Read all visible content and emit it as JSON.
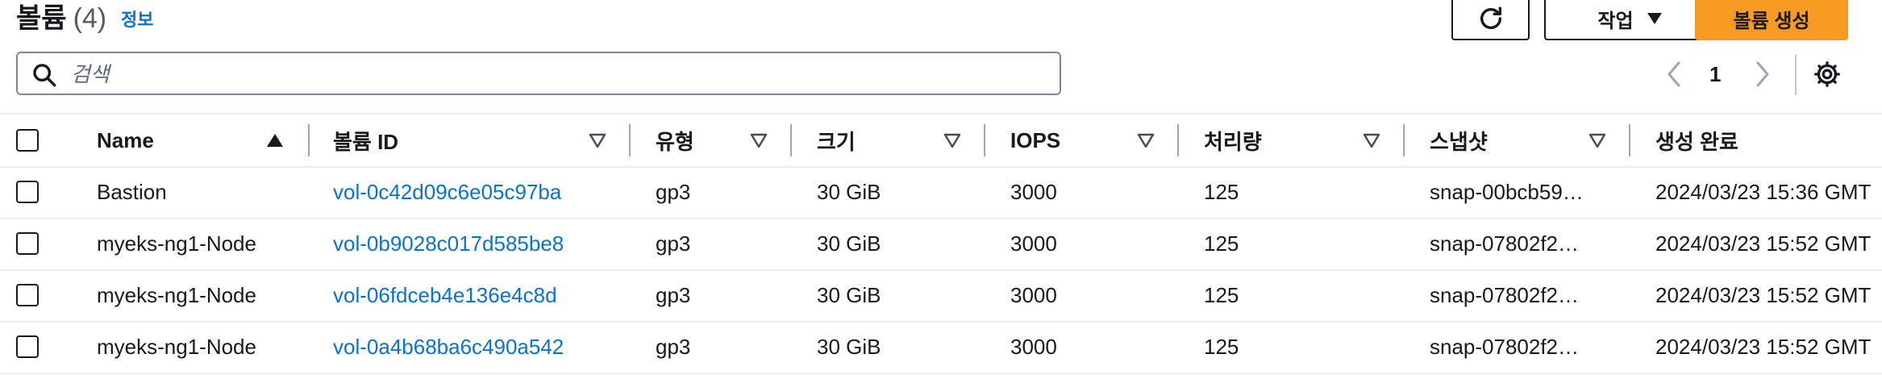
{
  "header": {
    "title": "볼륨",
    "count": "(4)",
    "info_link": "정보",
    "actions_label": "작업",
    "create_label": "볼륨 생성",
    "refresh_icon": "refresh-icon",
    "actions_caret_icon": "caret-down-icon"
  },
  "search": {
    "placeholder": "검색",
    "value": ""
  },
  "pagination": {
    "current_page": "1"
  },
  "colors": {
    "accent_link": "#0972d3",
    "primary_button": "#f89b22"
  },
  "table": {
    "columns": [
      "Name",
      "볼륨 ID",
      "유형",
      "크기",
      "IOPS",
      "처리량",
      "스냅샷",
      "생성 완료"
    ],
    "rows": [
      {
        "name": "Bastion",
        "volume_id": "vol-0c42d09c6e05c97ba",
        "type": "gp3",
        "size": "30 GiB",
        "iops": "3000",
        "throughput": "125",
        "snapshot": "snap-00bcb59…",
        "created": "2024/03/23 15:36 GMT"
      },
      {
        "name": "myeks-ng1-Node",
        "volume_id": "vol-0b9028c017d585be8",
        "type": "gp3",
        "size": "30 GiB",
        "iops": "3000",
        "throughput": "125",
        "snapshot": "snap-07802f2…",
        "created": "2024/03/23 15:52 GMT"
      },
      {
        "name": "myeks-ng1-Node",
        "volume_id": "vol-06fdceb4e136e4c8d",
        "type": "gp3",
        "size": "30 GiB",
        "iops": "3000",
        "throughput": "125",
        "snapshot": "snap-07802f2…",
        "created": "2024/03/23 15:52 GMT"
      },
      {
        "name": "myeks-ng1-Node",
        "volume_id": "vol-0a4b68ba6c490a542",
        "type": "gp3",
        "size": "30 GiB",
        "iops": "3000",
        "throughput": "125",
        "snapshot": "snap-07802f2…",
        "created": "2024/03/23 15:52 GMT"
      }
    ]
  }
}
